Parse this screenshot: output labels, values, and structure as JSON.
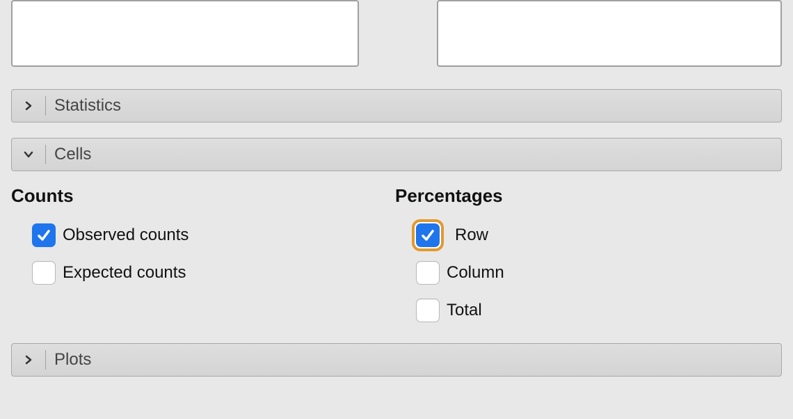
{
  "accordion": {
    "statistics_label": "Statistics",
    "cells_label": "Cells",
    "plots_label": "Plots"
  },
  "counts": {
    "heading": "Counts",
    "observed_label": "Observed counts",
    "expected_label": "Expected counts"
  },
  "percentages": {
    "heading": "Percentages",
    "row_label": "Row",
    "column_label": "Column",
    "total_label": "Total"
  }
}
